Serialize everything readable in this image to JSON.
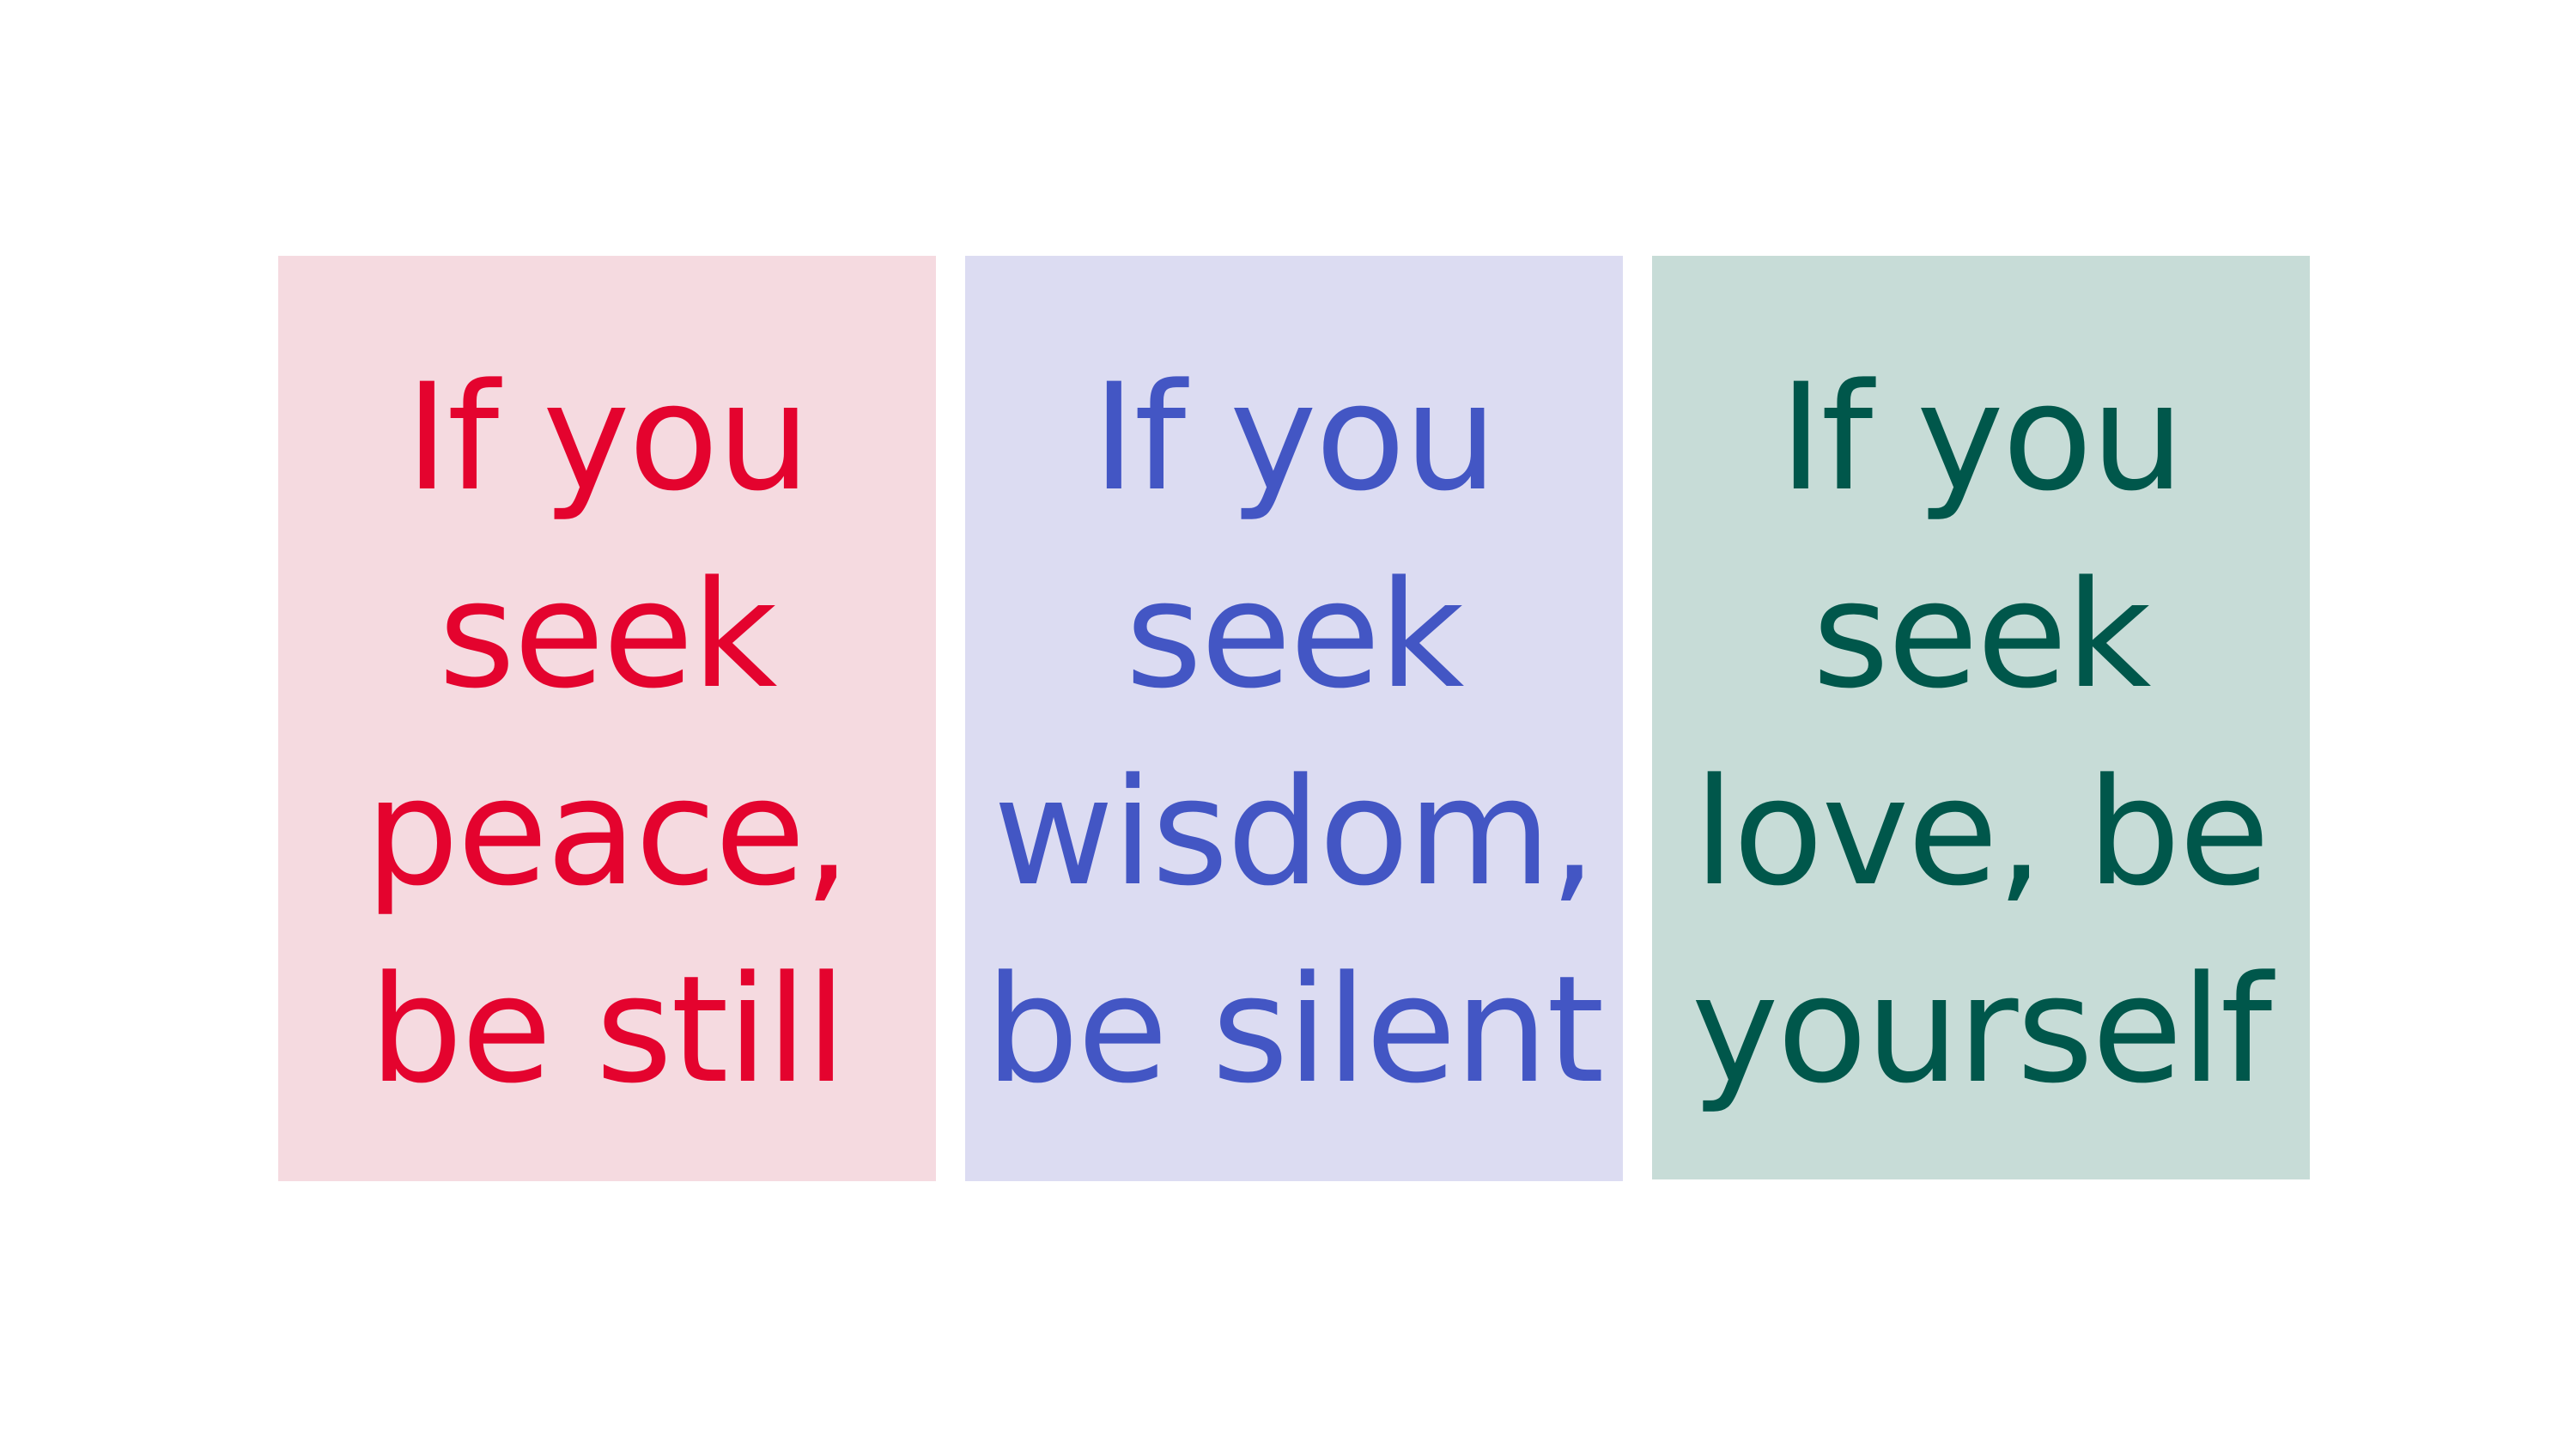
{
  "posters": [
    {
      "lines": [
        "If you",
        "seek",
        "peace,",
        "be still"
      ],
      "background": "#f5dae0",
      "text_color": "#e4032e"
    },
    {
      "lines": [
        "If you",
        "seek",
        "wisdom,",
        "be silent"
      ],
      "background": "#dcdcf2",
      "text_color": "#4356c4"
    },
    {
      "lines": [
        "If you",
        "seek",
        "love, be",
        "yourself"
      ],
      "background": "#c7dcd7",
      "text_color": "#00574b"
    }
  ]
}
